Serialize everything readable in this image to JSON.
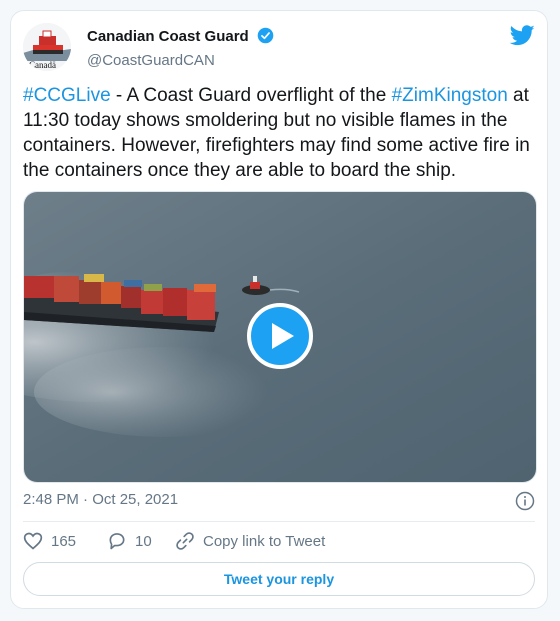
{
  "author": {
    "display_name": "Canadian Coast Guard",
    "handle": "@CoastGuardCAN",
    "verified": true,
    "avatar_label": "Canadä"
  },
  "tweet": {
    "hashtag1": "#CCGLive",
    "text1": " - A Coast Guard overflight of the ",
    "hashtag2": "#ZimKingston",
    "text2": " at 11:30 today shows smoldering but no visible flames in the containers. However, firefighters may find some active fire in the containers once they are able to board the ship."
  },
  "media": {
    "type": "video",
    "play_icon": "play-icon"
  },
  "meta": {
    "timestamp": "2:48 PM · Oct 25, 2021"
  },
  "actions": {
    "like_count": "165",
    "reply_count": "10",
    "copy_link_label": "Copy link to Tweet"
  },
  "reply_button": {
    "label": "Tweet your reply"
  },
  "colors": {
    "accent": "#1da1f2",
    "link": "#1b95e0",
    "secondary_text": "#657786"
  }
}
